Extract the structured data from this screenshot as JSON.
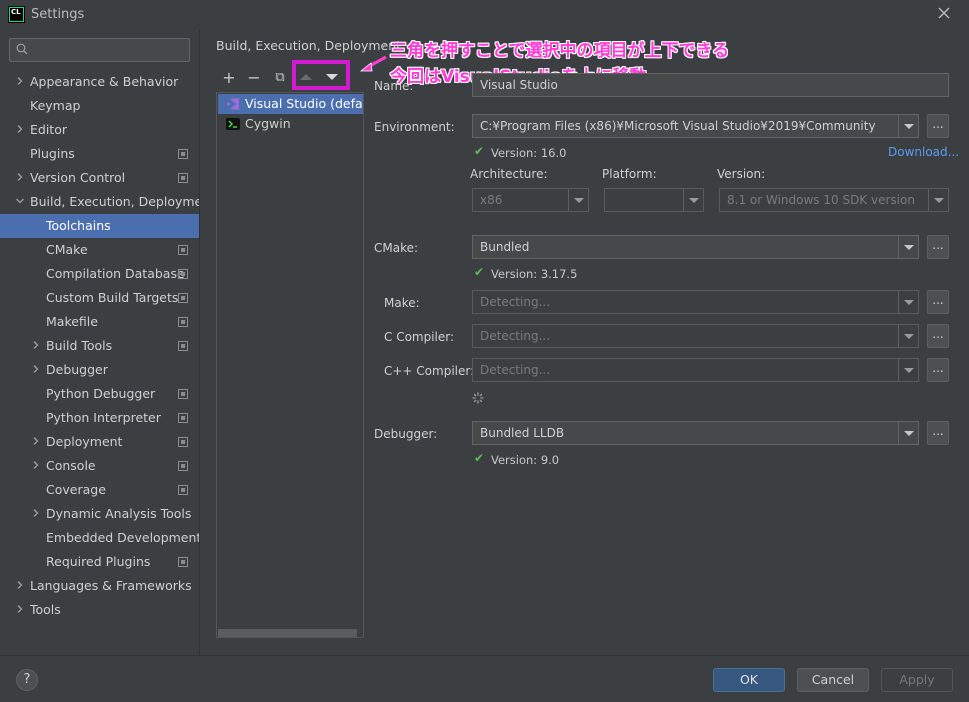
{
  "window": {
    "title": "Settings",
    "app_icon": "CL"
  },
  "sidebar": {
    "search_placeholder": "",
    "items": [
      {
        "label": "Appearance & Behavior",
        "arrow": ">",
        "level": 0,
        "project": false
      },
      {
        "label": "Keymap",
        "arrow": "",
        "level": 0,
        "project": false
      },
      {
        "label": "Editor",
        "arrow": ">",
        "level": 0,
        "project": false
      },
      {
        "label": "Plugins",
        "arrow": "",
        "level": 0,
        "project": true
      },
      {
        "label": "Version Control",
        "arrow": ">",
        "level": 0,
        "project": true
      },
      {
        "label": "Build, Execution, Deployment",
        "arrow": "v",
        "level": 0,
        "project": false
      },
      {
        "label": "Toolchains",
        "arrow": "",
        "level": 1,
        "project": false,
        "selected": true
      },
      {
        "label": "CMake",
        "arrow": "",
        "level": 1,
        "project": true
      },
      {
        "label": "Compilation Database",
        "arrow": "",
        "level": 1,
        "project": true
      },
      {
        "label": "Custom Build Targets",
        "arrow": "",
        "level": 1,
        "project": true
      },
      {
        "label": "Makefile",
        "arrow": "",
        "level": 1,
        "project": true
      },
      {
        "label": "Build Tools",
        "arrow": ">",
        "level": 1,
        "project": true
      },
      {
        "label": "Debugger",
        "arrow": ">",
        "level": 1,
        "project": false
      },
      {
        "label": "Python Debugger",
        "arrow": "",
        "level": 1,
        "project": true
      },
      {
        "label": "Python Interpreter",
        "arrow": "",
        "level": 1,
        "project": true
      },
      {
        "label": "Deployment",
        "arrow": ">",
        "level": 1,
        "project": true
      },
      {
        "label": "Console",
        "arrow": ">",
        "level": 1,
        "project": true
      },
      {
        "label": "Coverage",
        "arrow": "",
        "level": 1,
        "project": true
      },
      {
        "label": "Dynamic Analysis Tools",
        "arrow": ">",
        "level": 1,
        "project": false
      },
      {
        "label": "Embedded Development",
        "arrow": "",
        "level": 1,
        "project": false
      },
      {
        "label": "Required Plugins",
        "arrow": "",
        "level": 1,
        "project": true
      },
      {
        "label": "Languages & Frameworks",
        "arrow": ">",
        "level": 0,
        "project": false
      },
      {
        "label": "Tools",
        "arrow": ">",
        "level": 0,
        "project": false
      }
    ]
  },
  "breadcrumb": {
    "path": "Build, Execution, Deployment",
    "separator": "›"
  },
  "toolbar": {
    "add": "+",
    "remove": "−",
    "copy": "⧉"
  },
  "annotation": {
    "line1": "三角を押すことで選択中の項目が上下できる",
    "line2": "今回はVisualStudioを上に移動"
  },
  "toolchains": [
    {
      "label": "Visual Studio (default)",
      "selected": true,
      "icon": "visual-studio-icon"
    },
    {
      "label": "Cygwin",
      "selected": false,
      "icon": "cygwin-icon"
    }
  ],
  "form": {
    "name_label": "Name:",
    "name_value": "Visual Studio",
    "environment_label": "Environment:",
    "environment_value": "C:¥Program Files (x86)¥Microsoft Visual Studio¥2019¥Community",
    "environment_version": "Version: 16.0",
    "download_link": "Download...",
    "architecture_label": "Architecture:",
    "architecture_value": "x86",
    "platform_label": "Platform:",
    "platform_value": "",
    "version_label": "Version:",
    "version_value": "8.1 or Windows 10 SDK version",
    "cmake_label": "CMake:",
    "cmake_value": "Bundled",
    "cmake_version": "Version: 3.17.5",
    "make_label": "Make:",
    "make_value": "Detecting...",
    "c_compiler_label": "C Compiler:",
    "c_compiler_value": "Detecting...",
    "cpp_compiler_label": "C++ Compiler:",
    "cpp_compiler_value": "Detecting...",
    "debugger_label": "Debugger:",
    "debugger_value": "Bundled LLDB",
    "debugger_version": "Version: 9.0",
    "dots": "..."
  },
  "footer": {
    "help": "?",
    "ok": "OK",
    "cancel": "Cancel",
    "apply": "Apply"
  },
  "colors": {
    "selection": "#4b6eaf",
    "highlight": "#d21ad1",
    "annotation": "#ff3ad8",
    "check": "#5fb85a",
    "link": "#589df6"
  }
}
